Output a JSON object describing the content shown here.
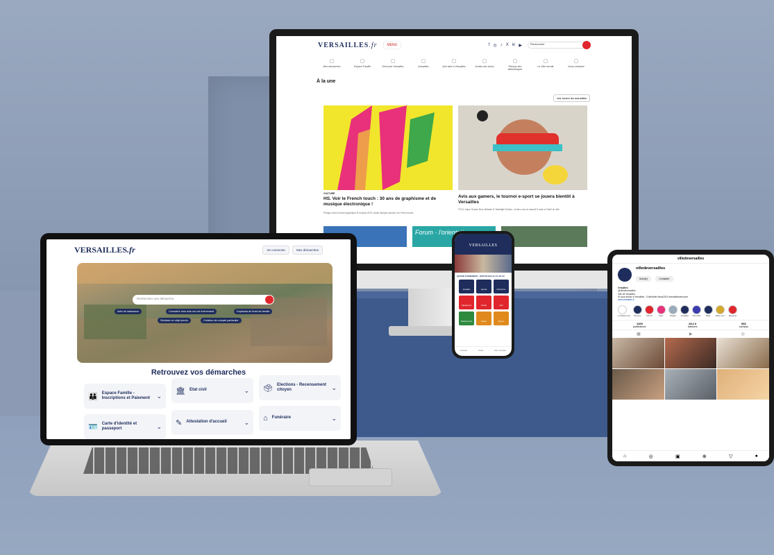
{
  "colors": {
    "navy": "#1e2d5c",
    "red": "#e0262c"
  },
  "monitor": {
    "logo": "VERSAILLES",
    "logo_ext": ".fr",
    "menu": "MENU",
    "socials": [
      "f",
      "◎",
      "♪",
      "X",
      "in",
      "▶"
    ],
    "search_placeholder": "Rechercher",
    "quick": [
      "Mes démarches",
      "Espace Famille",
      "Découvrir Versailles",
      "Actualités",
      "Que faire à Versailles",
      "Sorties des loisirs",
      "Réseau des bibliothèques",
      "La Ville recrute",
      "Nous contacter"
    ],
    "section": "À la une",
    "see_all": "Voir toutes les actualités",
    "card1": {
      "tag": "CULTURE",
      "title": "HS. Voir le French touch : 30 ans de graphisme et de musique électronique !",
      "desc": "Plongez dans l'univers graphique et musical d'HS, studio français associé à la French touch."
    },
    "card2": {
      "title": "Avis aux gamers, le tournoi e-sport se jouera bientôt à Versailles",
      "desc": "FC24, Super Smash Bros Ultimate et Teamfight Tactics : rendez-vous le samedi 5 mars à l'hôtel de ville."
    },
    "strip_text": "Forum · l'orientation"
  },
  "laptop": {
    "logo": "VERSAILLES",
    "logo_ext": ".fr",
    "btn1": "Se connecter",
    "btn2": "Mes démarches",
    "search_placeholder": "Rechercher une démarche",
    "chips": [
      "Acte de naissance",
      "Connaître mon avis sur cet événement",
      "Duplicata de livret de famille",
      "Déclarer un objet perdu",
      "Création de compte particulier"
    ],
    "title": "Retrouvez vos démarches",
    "tiles": [
      {
        "icon": "👪",
        "label": "Espace Famille - Inscriptions et Paiement"
      },
      {
        "icon": "🏛",
        "label": "Etat civil"
      },
      {
        "icon": "🗳",
        "label": "Elections - Recensement citoyen"
      },
      {
        "icon": "🪪",
        "label": "Carte d'identité et passeport"
      },
      {
        "icon": "✎",
        "label": "Attestation d'accueil"
      },
      {
        "icon": "⌂",
        "label": "Funéraire"
      }
    ]
  },
  "phone": {
    "logo": "VERSAILLES",
    "news": "GRAND ÉVÉNEMENT · DEPUIS MAI AU 21 ET 22",
    "tiles": [
      "Actualités",
      "Agenda",
      "Démarches",
      "Signalement",
      "Famille",
      "Jobs",
      "Stationnement",
      "Culture",
      "Recycl."
    ],
    "nav": [
      "Accueil",
      "Carte",
      "Mon compte"
    ]
  },
  "tablet": {
    "handle": "villedeversailles",
    "name": "villedeversailles",
    "follow": "Suivi(e)",
    "contact": "Contacter",
    "bio_lines": [
      "Versailles",
      "@villedeversailles",
      "Ville de Versailles",
      "Si vous arrivez à Versailles · Collectivité #tous2024 #versaillesdecouvrir",
      "www.versailles.fr"
    ],
    "highlights": [
      "Le Saviez-vous",
      "Parcours",
      "FLE 48",
      "Sport",
      "Visages",
      "Versailles",
      "VOL 2023",
      "Batel",
      "Fêtes musi..",
      "Bonjourdi"
    ],
    "stats": [
      {
        "n": "1165",
        "l": "publications"
      },
      {
        "n": "28,2 k",
        "l": "followers"
      },
      {
        "n": "966",
        "l": "suivi(e)s"
      }
    ]
  }
}
